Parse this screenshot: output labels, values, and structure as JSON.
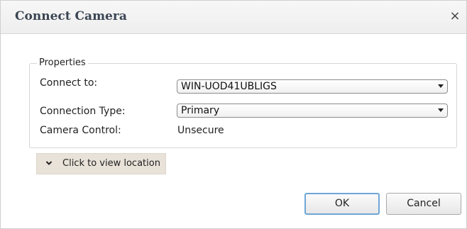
{
  "dialog": {
    "title": "Connect Camera",
    "close_glyph": "×"
  },
  "properties": {
    "legend": "Properties",
    "connect_to": {
      "label": "Connect to:",
      "value": "WIN-UOD41UBLIGS"
    },
    "connection_type": {
      "label": "Connection Type:",
      "value": "Primary"
    },
    "camera_control": {
      "label": "Camera Control:",
      "value": "Unsecure"
    }
  },
  "location_toggle": {
    "label": "Click to view location",
    "icon": "chevron-down-icon"
  },
  "buttons": {
    "ok": "OK",
    "cancel": "Cancel"
  }
}
